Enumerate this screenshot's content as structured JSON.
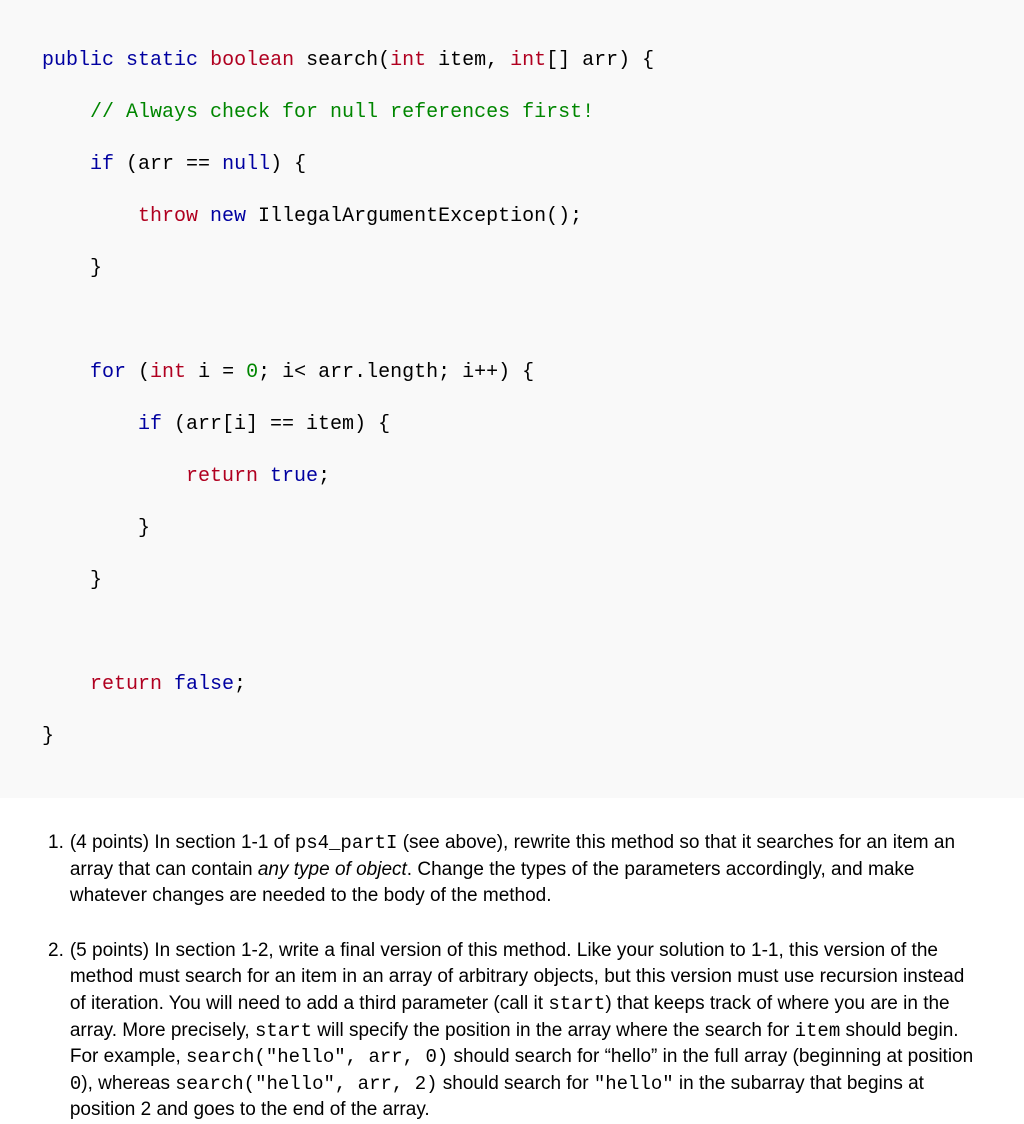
{
  "code": {
    "l1_public": "public",
    "l1_static": "static",
    "l1_boolean": "boolean",
    "l1_search": " search(",
    "l1_int1": "int",
    "l1_item": " item, ",
    "l1_int2": "int",
    "l1_arr": "[] arr) {",
    "l2_comment": "// Always check for null references first!",
    "l3_if": "if",
    "l3_rest": " (arr == ",
    "l3_null": "null",
    "l3_close": ") {",
    "l4_throw": "throw",
    "l4_new": " new",
    "l4_exc": " IllegalArgumentException();",
    "l5": "}",
    "l7_for": "for",
    "l7_rest1": " (",
    "l7_int": "int",
    "l7_rest2": " i = ",
    "l7_zero": "0",
    "l7_rest3": "; i< arr.length; i++) {",
    "l8_if": "if",
    "l8_rest": " (arr[i] == item) {",
    "l9_return": "return",
    "l9_true": " true",
    "l9_semi": ";",
    "l10": "}",
    "l11": "}",
    "l13_return": "return",
    "l13_false": " false",
    "l13_semi": ";",
    "l14": "}"
  },
  "q1": {
    "num": "1.",
    "points": "(4 points) In section 1-1 of ",
    "ps4": "ps4_partI",
    "mid1": " (see above), rewrite this method so that it searches for an item an array that can contain ",
    "anytype": "any type of object",
    "mid2": ". Change the types of the parameters accordingly, and make whatever changes are needed to the body of the method."
  },
  "q2": {
    "num": "2.",
    "t1": "(5 points) In section 1-2, write a final version of this method. Like your solution to 1-1, this version of the method must search for an item in an array of arbitrary objects, but this version must use recursion instead of iteration. You will need to add a third parameter (call it ",
    "start1": "start",
    "t2": ") that keeps track of where you are in the array. More precisely, ",
    "start2": "start",
    "t3": " will specify the position in the array where the search for ",
    "item": "item",
    "t4": " should begin. For example, ",
    "call1": "search(\"hello\", arr, 0)",
    "t5": " should search for “hello” in the full array (beginning at position ",
    "zero": "0",
    "t6": "), whereas ",
    "call2": "search(\"hello\", arr, 2)",
    "t7": " should search for ",
    "hello": "\"hello\"",
    "t8": " in the subarray that begins at position 2 and goes to the end of the array."
  }
}
